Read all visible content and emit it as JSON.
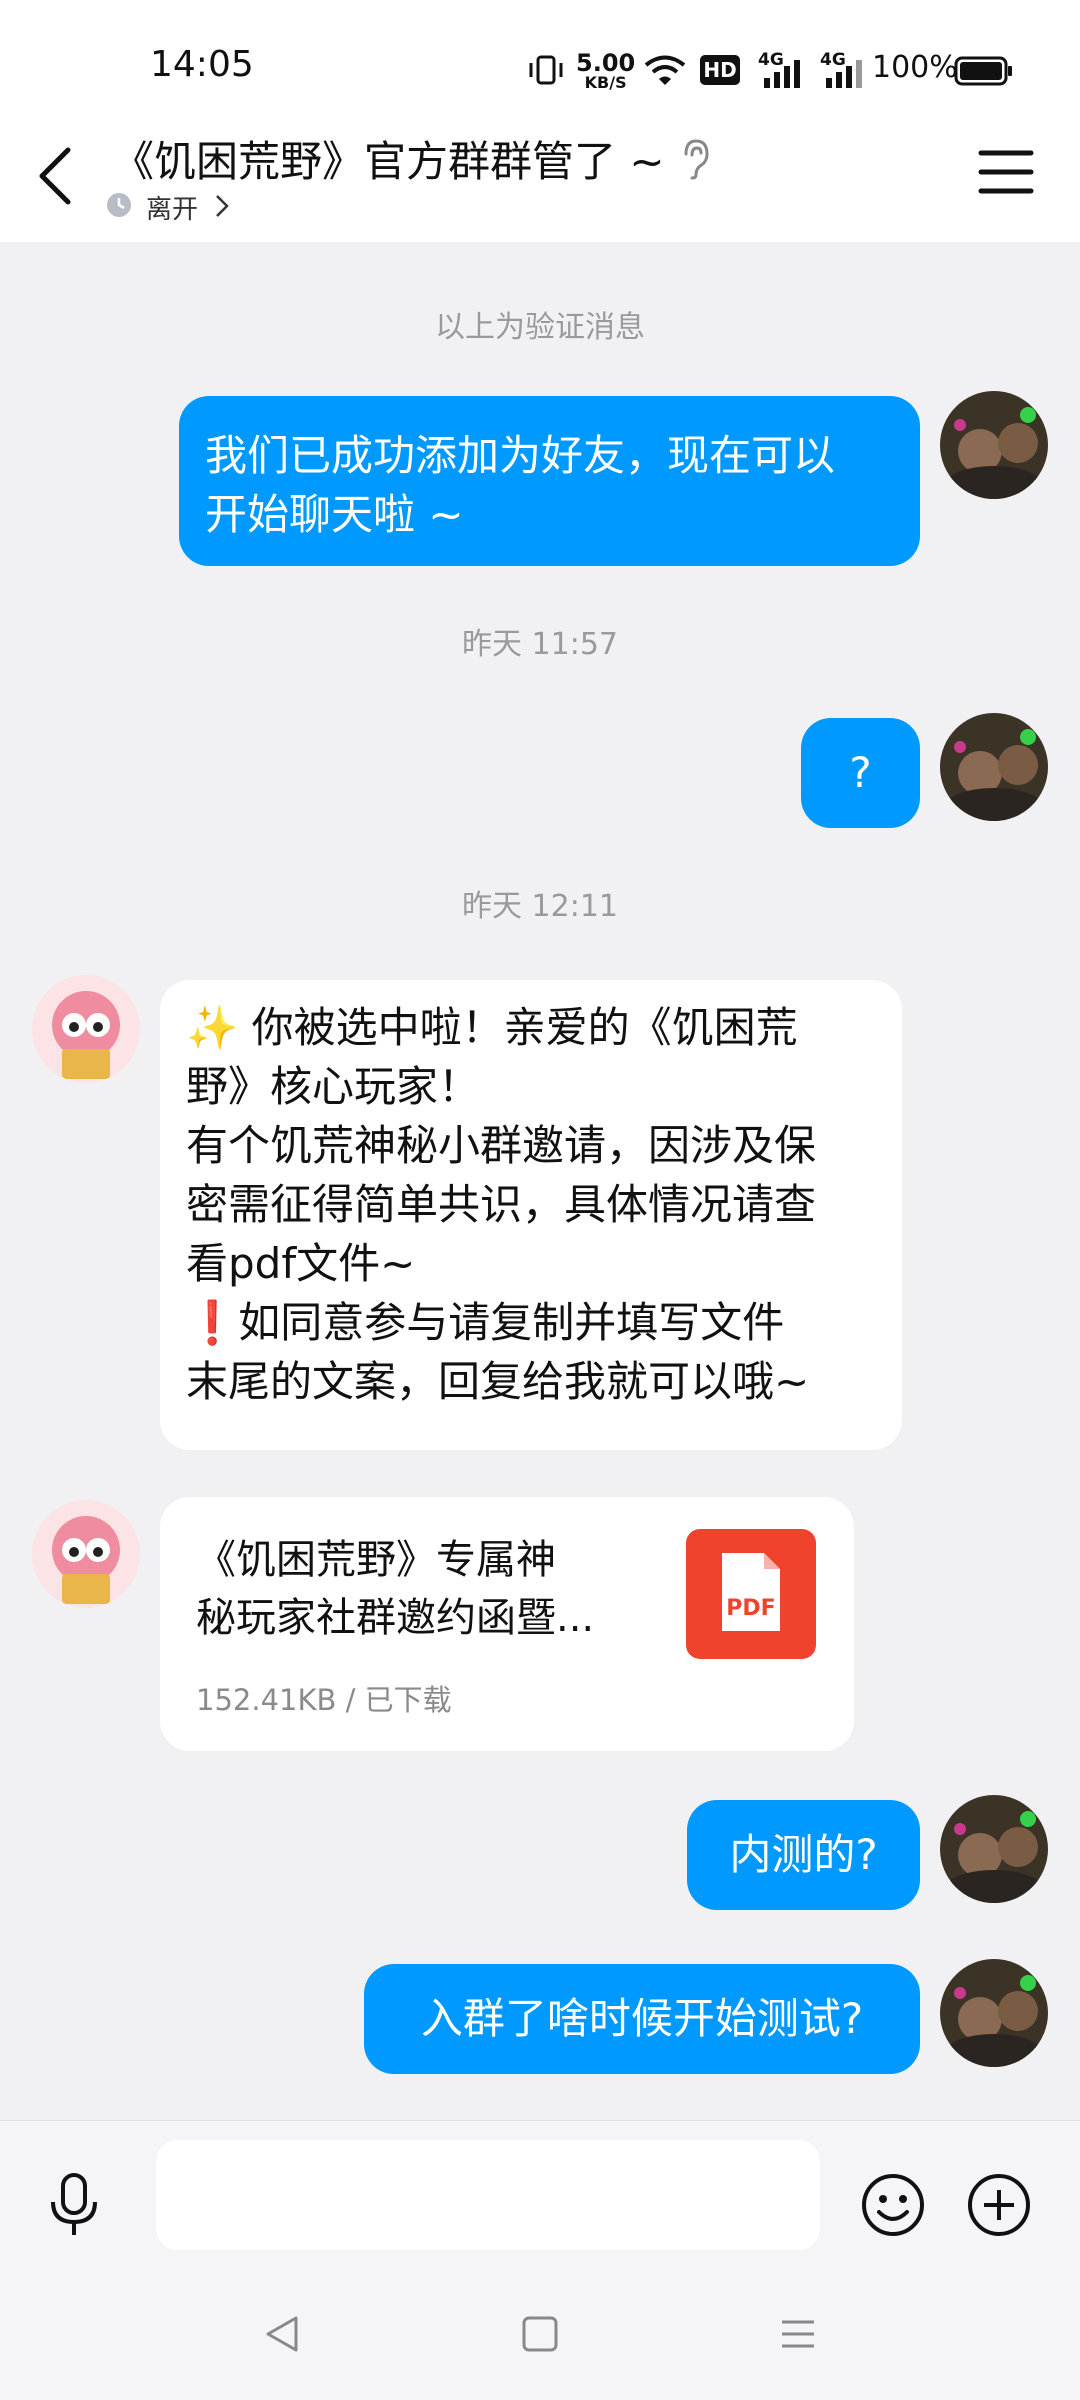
{
  "status_bar": {
    "time": "14:05",
    "net_speed_value": "5.00",
    "net_speed_unit": "KB/S",
    "hd_label": "HD",
    "network_1": "4G",
    "network_2": "4G",
    "battery": "100%"
  },
  "header": {
    "title": "《饥困荒野》官方群群管了 ~",
    "status": "离开",
    "icons": [
      "back-arrow-icon",
      "ear-icon",
      "clock-icon",
      "chevron-right-icon",
      "menu-icon"
    ]
  },
  "messages": {
    "system_notice": "以上为验证消息",
    "msg1": {
      "line1": "我们已成功添加为好友，现在可以",
      "line2": "开始聊天啦 ~"
    },
    "time1": "昨天 11:57",
    "msg2": "?",
    "time2": "昨天 12:11",
    "msg3": {
      "emoji": "✨",
      "line1": " 你被选中啦！亲爱的《饥困荒",
      "line2": "野》核心玩家！",
      "line3": "有个饥荒神秘小群邀请，因涉及保",
      "line4": "密需征得简单共识，具体情况请查",
      "line5": "看pdf文件~",
      "mark": "❗",
      "line6": "如同意参与请复制并填写文件",
      "line7": "末尾的文案，回复给我就可以哦~"
    },
    "file": {
      "name_line1": "《饥困荒野》专属神",
      "name_line2": "秘玩家社群邀约函暨...",
      "meta": "152.41KB / 已下载",
      "type_label": "PDF"
    },
    "msg4": "内测的?",
    "msg5": "入群了啥时候开始测试?"
  },
  "input_bar": {
    "placeholder": "",
    "icons": [
      "microphone-icon",
      "emoji-icon",
      "plus-icon"
    ]
  },
  "nav_bar": {
    "icons": [
      "nav-back-icon",
      "nav-home-icon",
      "nav-menu-icon"
    ]
  },
  "colors": {
    "my_bubble": "#0099FF",
    "other_bubble": "#FFFFFF",
    "background": "#F1F1F4",
    "pdf_icon": "#F0432E"
  }
}
